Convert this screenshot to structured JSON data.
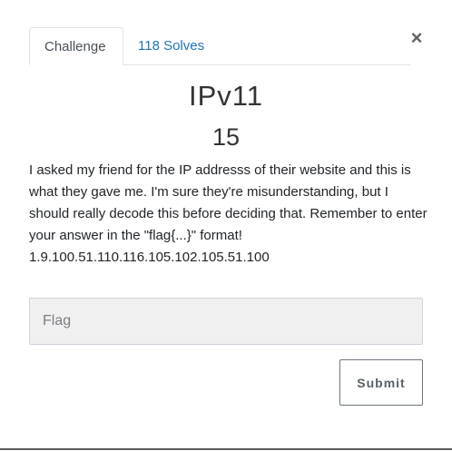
{
  "tabs": [
    {
      "label": "Challenge"
    },
    {
      "label": "118 Solves"
    }
  ],
  "close_glyph": "×",
  "challenge": {
    "name": "IPv11",
    "points": "15",
    "description": "I asked my friend for the IP addresss of their website and this is what they gave me. I'm sure they're misunderstanding, but I should really decode this before deciding that. Remember to enter your answer in the \"flag{...}\" format!",
    "ip": "1.9.100.51.110.116.105.102.105.51.100"
  },
  "flag_input": {
    "placeholder": "Flag",
    "value": ""
  },
  "submit_label": "Submit"
}
